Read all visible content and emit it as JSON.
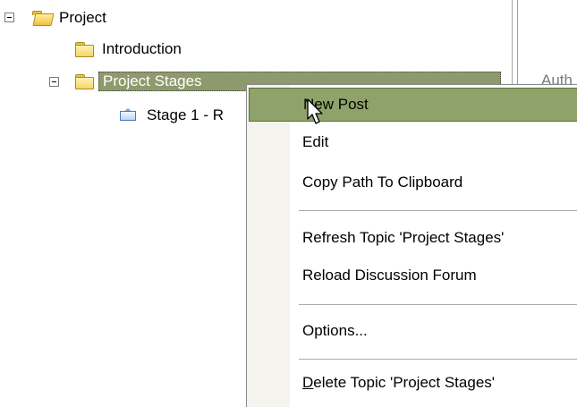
{
  "tree": {
    "root": {
      "label": "Project",
      "icon": "open-folder-icon"
    },
    "items": [
      {
        "label": "Introduction",
        "icon": "folder-icon"
      },
      {
        "label": "Project Stages",
        "icon": "folder-icon",
        "selected": true
      },
      {
        "label": "Stage 1 - R",
        "icon": "post-envelope-icon"
      }
    ]
  },
  "right_pane": {
    "partial_label": "Auth"
  },
  "context_menu": {
    "items": [
      {
        "label": "New Post",
        "highlighted": true
      },
      {
        "label": "Edit"
      },
      {
        "label": "Copy Path To Clipboard"
      },
      {
        "label": "Refresh Topic 'Project Stages'"
      },
      {
        "label": "Reload Discussion Forum"
      },
      {
        "label": "Options..."
      },
      {
        "label_prefix": "D",
        "label_rest": "elete Topic 'Project Stages'"
      }
    ]
  },
  "colors": {
    "selection": "#8f9a6c",
    "menu_highlight": "#8fa26a"
  }
}
